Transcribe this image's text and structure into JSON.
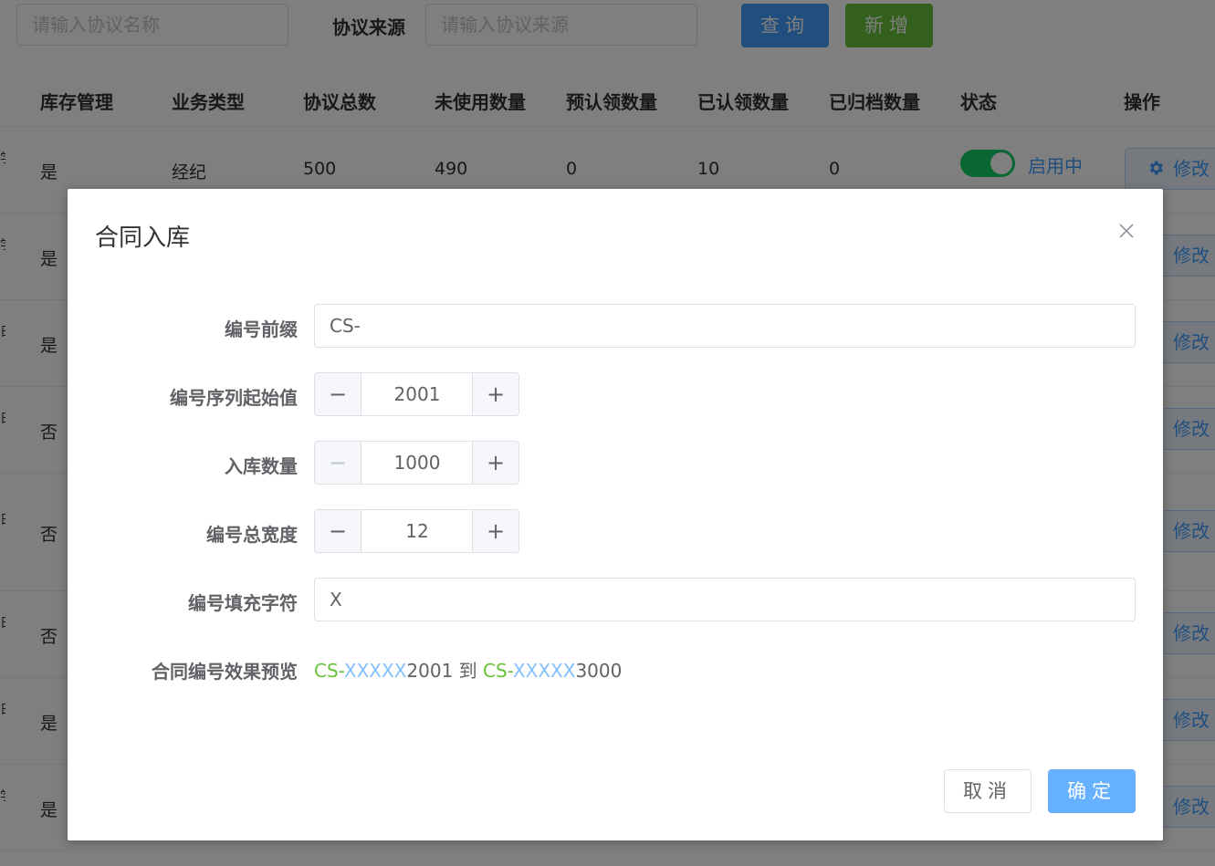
{
  "toolbar": {
    "name_placeholder": "请输入协议名称",
    "source_label": "协议来源",
    "source_placeholder": "请输入协议来源",
    "query_btn": "查询",
    "add_btn": "新增"
  },
  "table": {
    "columns": [
      "库存管理",
      "业务类型",
      "协议总数",
      "未使用数量",
      "预认领数量",
      "已认领数量",
      "已归档数量",
      "状态",
      "操作"
    ],
    "first_row": {
      "stock": "是",
      "biz": "经纪",
      "total": "500",
      "unused": "490",
      "pre": "0",
      "claimed": "10",
      "archived": "0",
      "status": "启用中",
      "edit": "修改"
    },
    "rows_stock": [
      "是",
      "是",
      "否",
      "否",
      "否",
      "是",
      "是"
    ],
    "edit_label": "修改",
    "edge_glyphs": [
      "学",
      "学",
      "日",
      "日",
      "日",
      "日",
      "日",
      "学"
    ]
  },
  "dialog": {
    "title": "合同入库",
    "fields": {
      "prefix_label": "编号前缀",
      "prefix_value": "CS-",
      "start_label": "编号序列起始值",
      "start_value": "2001",
      "count_label": "入库数量",
      "count_value": "1000",
      "width_label": "编号总宽度",
      "width_value": "12",
      "fill_label": "编号填充字符",
      "fill_value": "X",
      "preview_label": "合同编号效果预览"
    },
    "preview": {
      "prefix1": "CS-",
      "fill1": "XXXXX",
      "num1": "2001",
      "to": " 到 ",
      "prefix2": "CS-",
      "fill2": "XXXXX",
      "num2": "3000"
    },
    "cancel": "取消",
    "confirm": "确定"
  },
  "colors": {
    "primary": "#409eff",
    "success": "#67c23a",
    "switch_on": "#13ce66"
  },
  "icons": [
    "close-icon",
    "gear-icon",
    "minus-icon",
    "plus-icon"
  ]
}
